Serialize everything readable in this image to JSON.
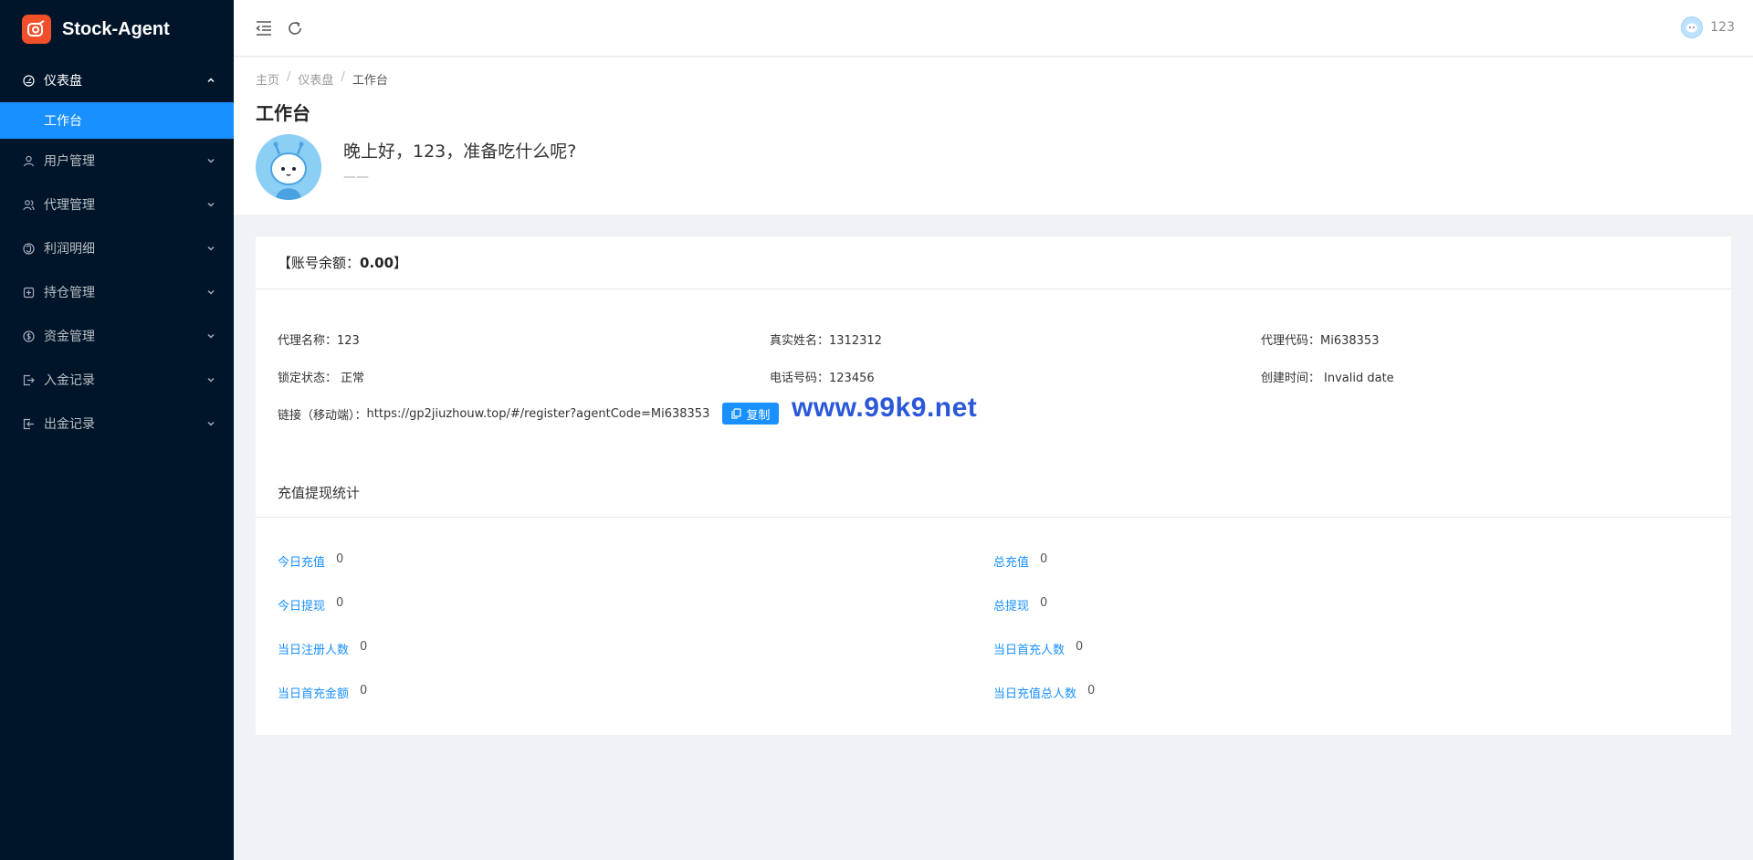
{
  "app": {
    "name": "Stock-Agent"
  },
  "sidebar": {
    "menus": [
      {
        "label": "仪表盘",
        "icon": "dashboard-icon"
      },
      {
        "label": "用户管理",
        "icon": "user-icon"
      },
      {
        "label": "代理管理",
        "icon": "team-icon"
      },
      {
        "label": "利润明细",
        "icon": "profit-icon"
      },
      {
        "label": "持仓管理",
        "icon": "position-icon"
      },
      {
        "label": "资金管理",
        "icon": "money-icon"
      },
      {
        "label": "入金记录",
        "icon": "deposit-icon"
      },
      {
        "label": "出金记录",
        "icon": "withdraw-icon"
      }
    ],
    "active_sub": "工作台"
  },
  "header": {
    "username": "123"
  },
  "breadcrumb": [
    "主页",
    "仪表盘",
    "工作台"
  ],
  "page": {
    "title": "工作台",
    "greeting": "晚上好，123，准备吃什么呢?",
    "greeting_sub": "——"
  },
  "account": {
    "balance_label": "【账号余额：",
    "balance_value": "0.00",
    "balance_close": "】",
    "fields": {
      "agent_name_label": "代理名称：",
      "agent_name": "123",
      "real_name_label": "真实姓名：",
      "real_name": "1312312",
      "agent_code_label": "代理代码：",
      "agent_code": "Mi638353",
      "lock_label": "锁定状态：",
      "lock_status": "正常",
      "phone_label": "电话号码：",
      "phone": "123456",
      "created_label": "创建时间：",
      "created": "Invalid date",
      "link_label": "链接（移动端）：",
      "link": "https://gp2jiuzhouw.top/#/register?agentCode=Mi638353",
      "copy_label": "复制"
    },
    "watermark": "www.99k9.net"
  },
  "stats": {
    "title": "充值提现统计",
    "items": [
      {
        "label": "今日充值",
        "value": "0"
      },
      {
        "label": "总充值",
        "value": "0"
      },
      {
        "label": "今日提现",
        "value": "0"
      },
      {
        "label": "总提现",
        "value": "0"
      },
      {
        "label": "当日注册人数",
        "value": "0"
      },
      {
        "label": "当日首充人数",
        "value": "0"
      },
      {
        "label": "当日首充金额",
        "value": "0"
      },
      {
        "label": "当日充值总人数",
        "value": "0"
      }
    ]
  }
}
